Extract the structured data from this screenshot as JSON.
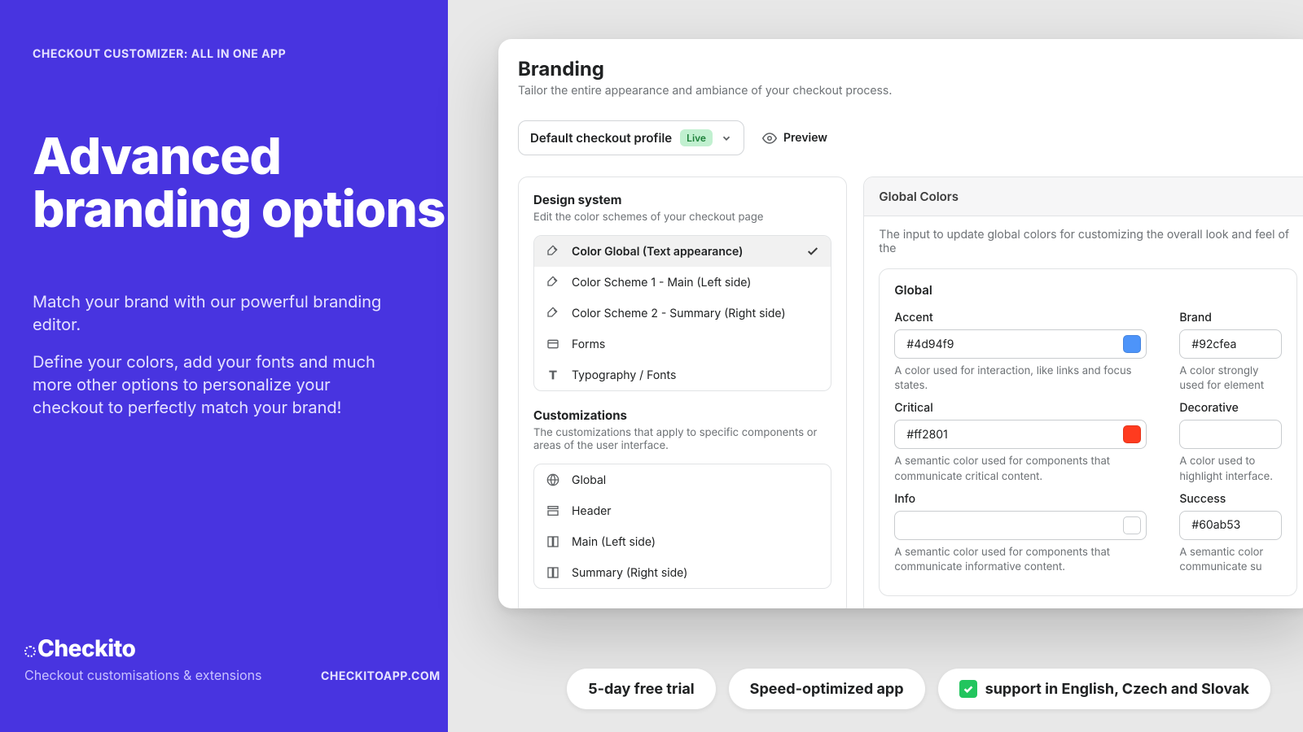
{
  "eyebrow": "CHECKOUT CUSTOMIZER: ALL IN ONE APP",
  "headline": "Advanced branding options",
  "sub1": "Match your brand with our powerful branding editor.",
  "sub2": "Define your colors, add your fonts and much more other options to personalize your checkout to perfectly match your brand!",
  "logo": "heckito",
  "tagline": "Checkout customisations & extensions",
  "site_url": "CHECKITOAPP.COM",
  "app": {
    "title": "Branding",
    "subtitle": "Tailor the entire appearance and ambiance of your checkout process.",
    "profile_name": "Default checkout profile",
    "live_badge": "Live",
    "preview": "Preview",
    "design_system": {
      "title": "Design system",
      "subtitle": "Edit the color schemes of your checkout page",
      "items": [
        "Color Global (Text appearance)",
        "Color Scheme 1 - Main (Left side)",
        "Color Scheme 2 - Summary (Right side)",
        "Forms",
        "Typography / Fonts"
      ]
    },
    "customizations": {
      "title": "Customizations",
      "subtitle": "The customizations that apply to specific components or areas of the user interface.",
      "items": [
        "Global",
        "Header",
        "Main (Left side)",
        "Summary (Right side)"
      ]
    },
    "global_colors": {
      "header": "Global Colors",
      "desc": "The input to update global colors for customizing the overall look and feel of the",
      "card_title": "Global",
      "fields": {
        "accent": {
          "label": "Accent",
          "value": "#4d94f9",
          "help": "A color used for interaction, like links and focus states.",
          "swatch": "#4d94f9"
        },
        "brand": {
          "label": "Brand",
          "value": "#92cfea",
          "help": "A color strongly used for element"
        },
        "critical": {
          "label": "Critical",
          "value": "#ff2801",
          "help": "A semantic color used for components that communicate critical content.",
          "swatch": "#ff3b1f"
        },
        "decorative": {
          "label": "Decorative",
          "value": "",
          "help": "A color used to highlight interface."
        },
        "info": {
          "label": "Info",
          "value": "",
          "help": "A semantic color used for components that communicate informative content.",
          "swatch": "#ffffff"
        },
        "success": {
          "label": "Success",
          "value": "#60ab53",
          "help": "A semantic color communicate su"
        }
      }
    }
  },
  "pills": {
    "trial": "5-day free trial",
    "speed": "Speed-optimized app",
    "support": "support in English, Czech and Slovak"
  }
}
